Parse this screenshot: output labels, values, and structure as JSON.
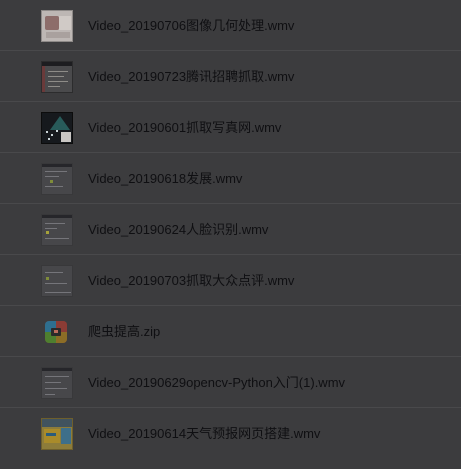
{
  "files": [
    {
      "name": "Video_20190706图像几何处理.wmv",
      "icon": "video-thumbnail-icon"
    },
    {
      "name": "Video_20190723腾讯招聘抓取.wmv",
      "icon": "video-thumbnail-icon"
    },
    {
      "name": "Video_20190601抓取写真网.wmv",
      "icon": "video-thumbnail-icon"
    },
    {
      "name": "Video_20190618发展.wmv",
      "icon": "video-thumbnail-icon"
    },
    {
      "name": "Video_20190624人脸识别.wmv",
      "icon": "video-thumbnail-icon"
    },
    {
      "name": "Video_20190703抓取大众点评.wmv",
      "icon": "video-thumbnail-icon"
    },
    {
      "name": "爬虫提高.zip",
      "icon": "zip-archive-icon"
    },
    {
      "name": "Video_20190629opencv-Python入门(1).wmv",
      "icon": "video-thumbnail-icon"
    },
    {
      "name": "Video_20190614天气预报网页搭建.wmv",
      "icon": "video-thumbnail-icon"
    }
  ],
  "colors": {
    "background": "#3c3c3e",
    "text": "#0f0f12",
    "divider": "#49494b"
  }
}
